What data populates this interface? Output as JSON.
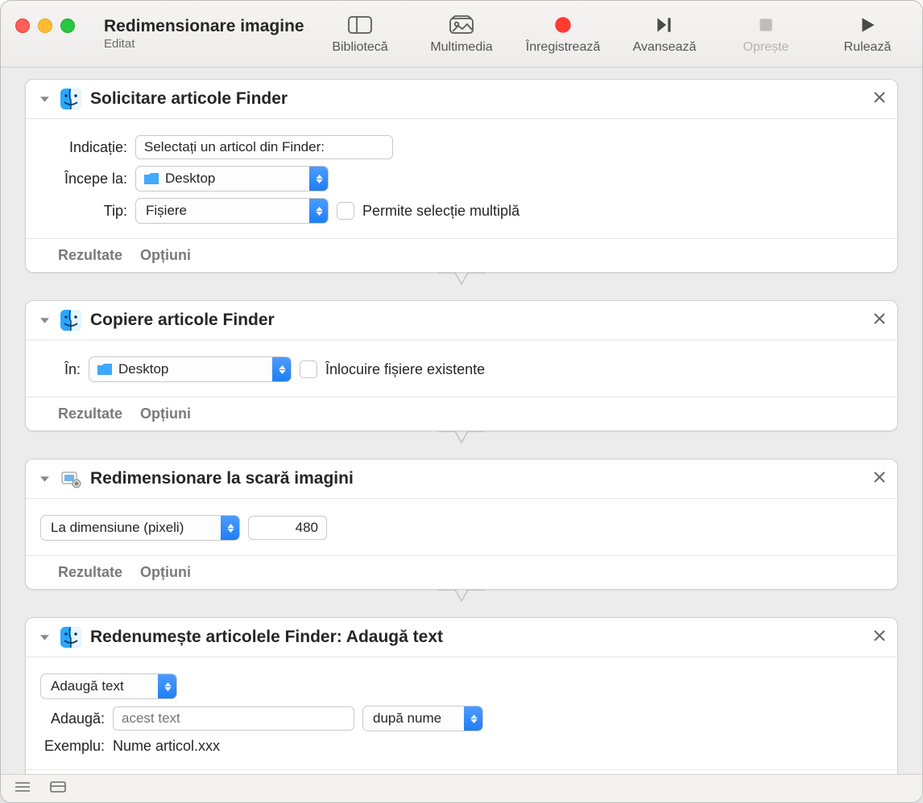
{
  "window": {
    "title": "Redimensionare imagine",
    "subtitle": "Editat"
  },
  "toolbar": [
    {
      "id": "library",
      "label": "Bibliotecă",
      "disabled": false
    },
    {
      "id": "media",
      "label": "Multimedia",
      "disabled": false
    },
    {
      "id": "record",
      "label": "Înregistrează",
      "disabled": false
    },
    {
      "id": "step",
      "label": "Avansează",
      "disabled": false
    },
    {
      "id": "stop",
      "label": "Oprește",
      "disabled": true
    },
    {
      "id": "run",
      "label": "Rulează",
      "disabled": false
    }
  ],
  "footer_labels": {
    "results": "Rezultate",
    "options": "Opțiuni"
  },
  "actions": {
    "a1": {
      "title": "Solicitare articole Finder",
      "prompt_label": "Indicație:",
      "prompt_value": "Selectați un articol din Finder:",
      "start_label": "Începe la:",
      "start_value": "Desktop",
      "type_label": "Tip:",
      "type_value": "Fișiere",
      "multi_label": "Permite selecție multiplă"
    },
    "a2": {
      "title": "Copiere articole Finder",
      "in_label": "În:",
      "in_value": "Desktop",
      "replace_label": "Înlocuire fișiere existente"
    },
    "a3": {
      "title": "Redimensionare la scară imagini",
      "mode_value": "La dimensiune (pixeli)",
      "size_value": "480"
    },
    "a4": {
      "title": "Redenumește articolele Finder: Adaugă text",
      "mode_value": "Adaugă text",
      "add_label": "Adaugă:",
      "add_placeholder": "acest text",
      "pos_value": "după nume",
      "example_label": "Exemplu:",
      "example_value": "Nume articol.xxx"
    }
  }
}
